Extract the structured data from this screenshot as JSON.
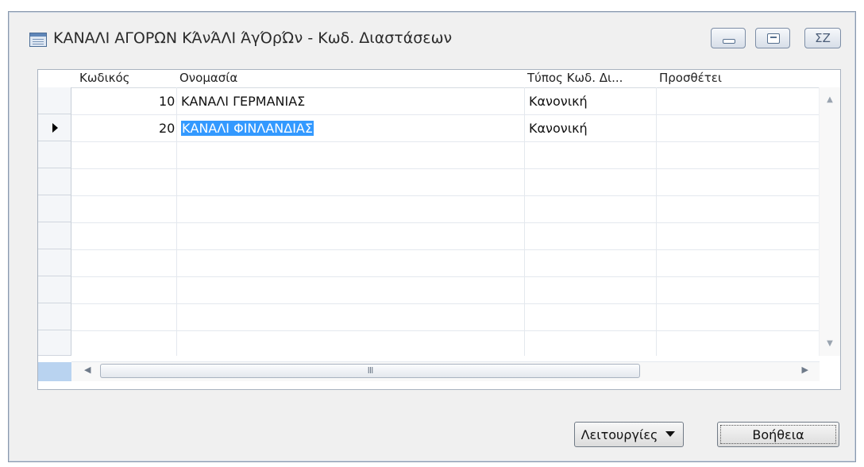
{
  "window": {
    "title": "ΚΑΝΑΛΙ ΑΓΟΡΩΝ ΚΆνΆΛΙ ΆγΌρΏν - Κωδ. Διαστάσεων",
    "icon": "form-icon",
    "controls": {
      "minimize": "minimize-icon",
      "maximize": "maximize-icon",
      "close": "ΣΖ"
    }
  },
  "grid": {
    "columns": [
      "Κωδικός",
      "Ονομασία",
      "Τύπος Κωδ. Δι...",
      "Προσθέτει"
    ],
    "rows": [
      {
        "code": "10",
        "name": "ΚΑΝΑΛΙ ΓΕΡΜΑΝΙΑΣ",
        "type": "Κανονική",
        "adds": ""
      },
      {
        "code": "20",
        "name": "ΚΑΝΑΛΙ ΦΙΝΛΑΝΔΙΑΣ",
        "type": "Κανονική",
        "adds": ""
      }
    ],
    "current_row_index": 1,
    "selected_cell": "name",
    "hscroll_grip": "III"
  },
  "buttons": {
    "functions": "Λειτουργίες",
    "help": "Βοήθεια"
  },
  "colors": {
    "selection": "#3399ff",
    "frame": "#8a99ad",
    "background": "#f0f0f0"
  }
}
